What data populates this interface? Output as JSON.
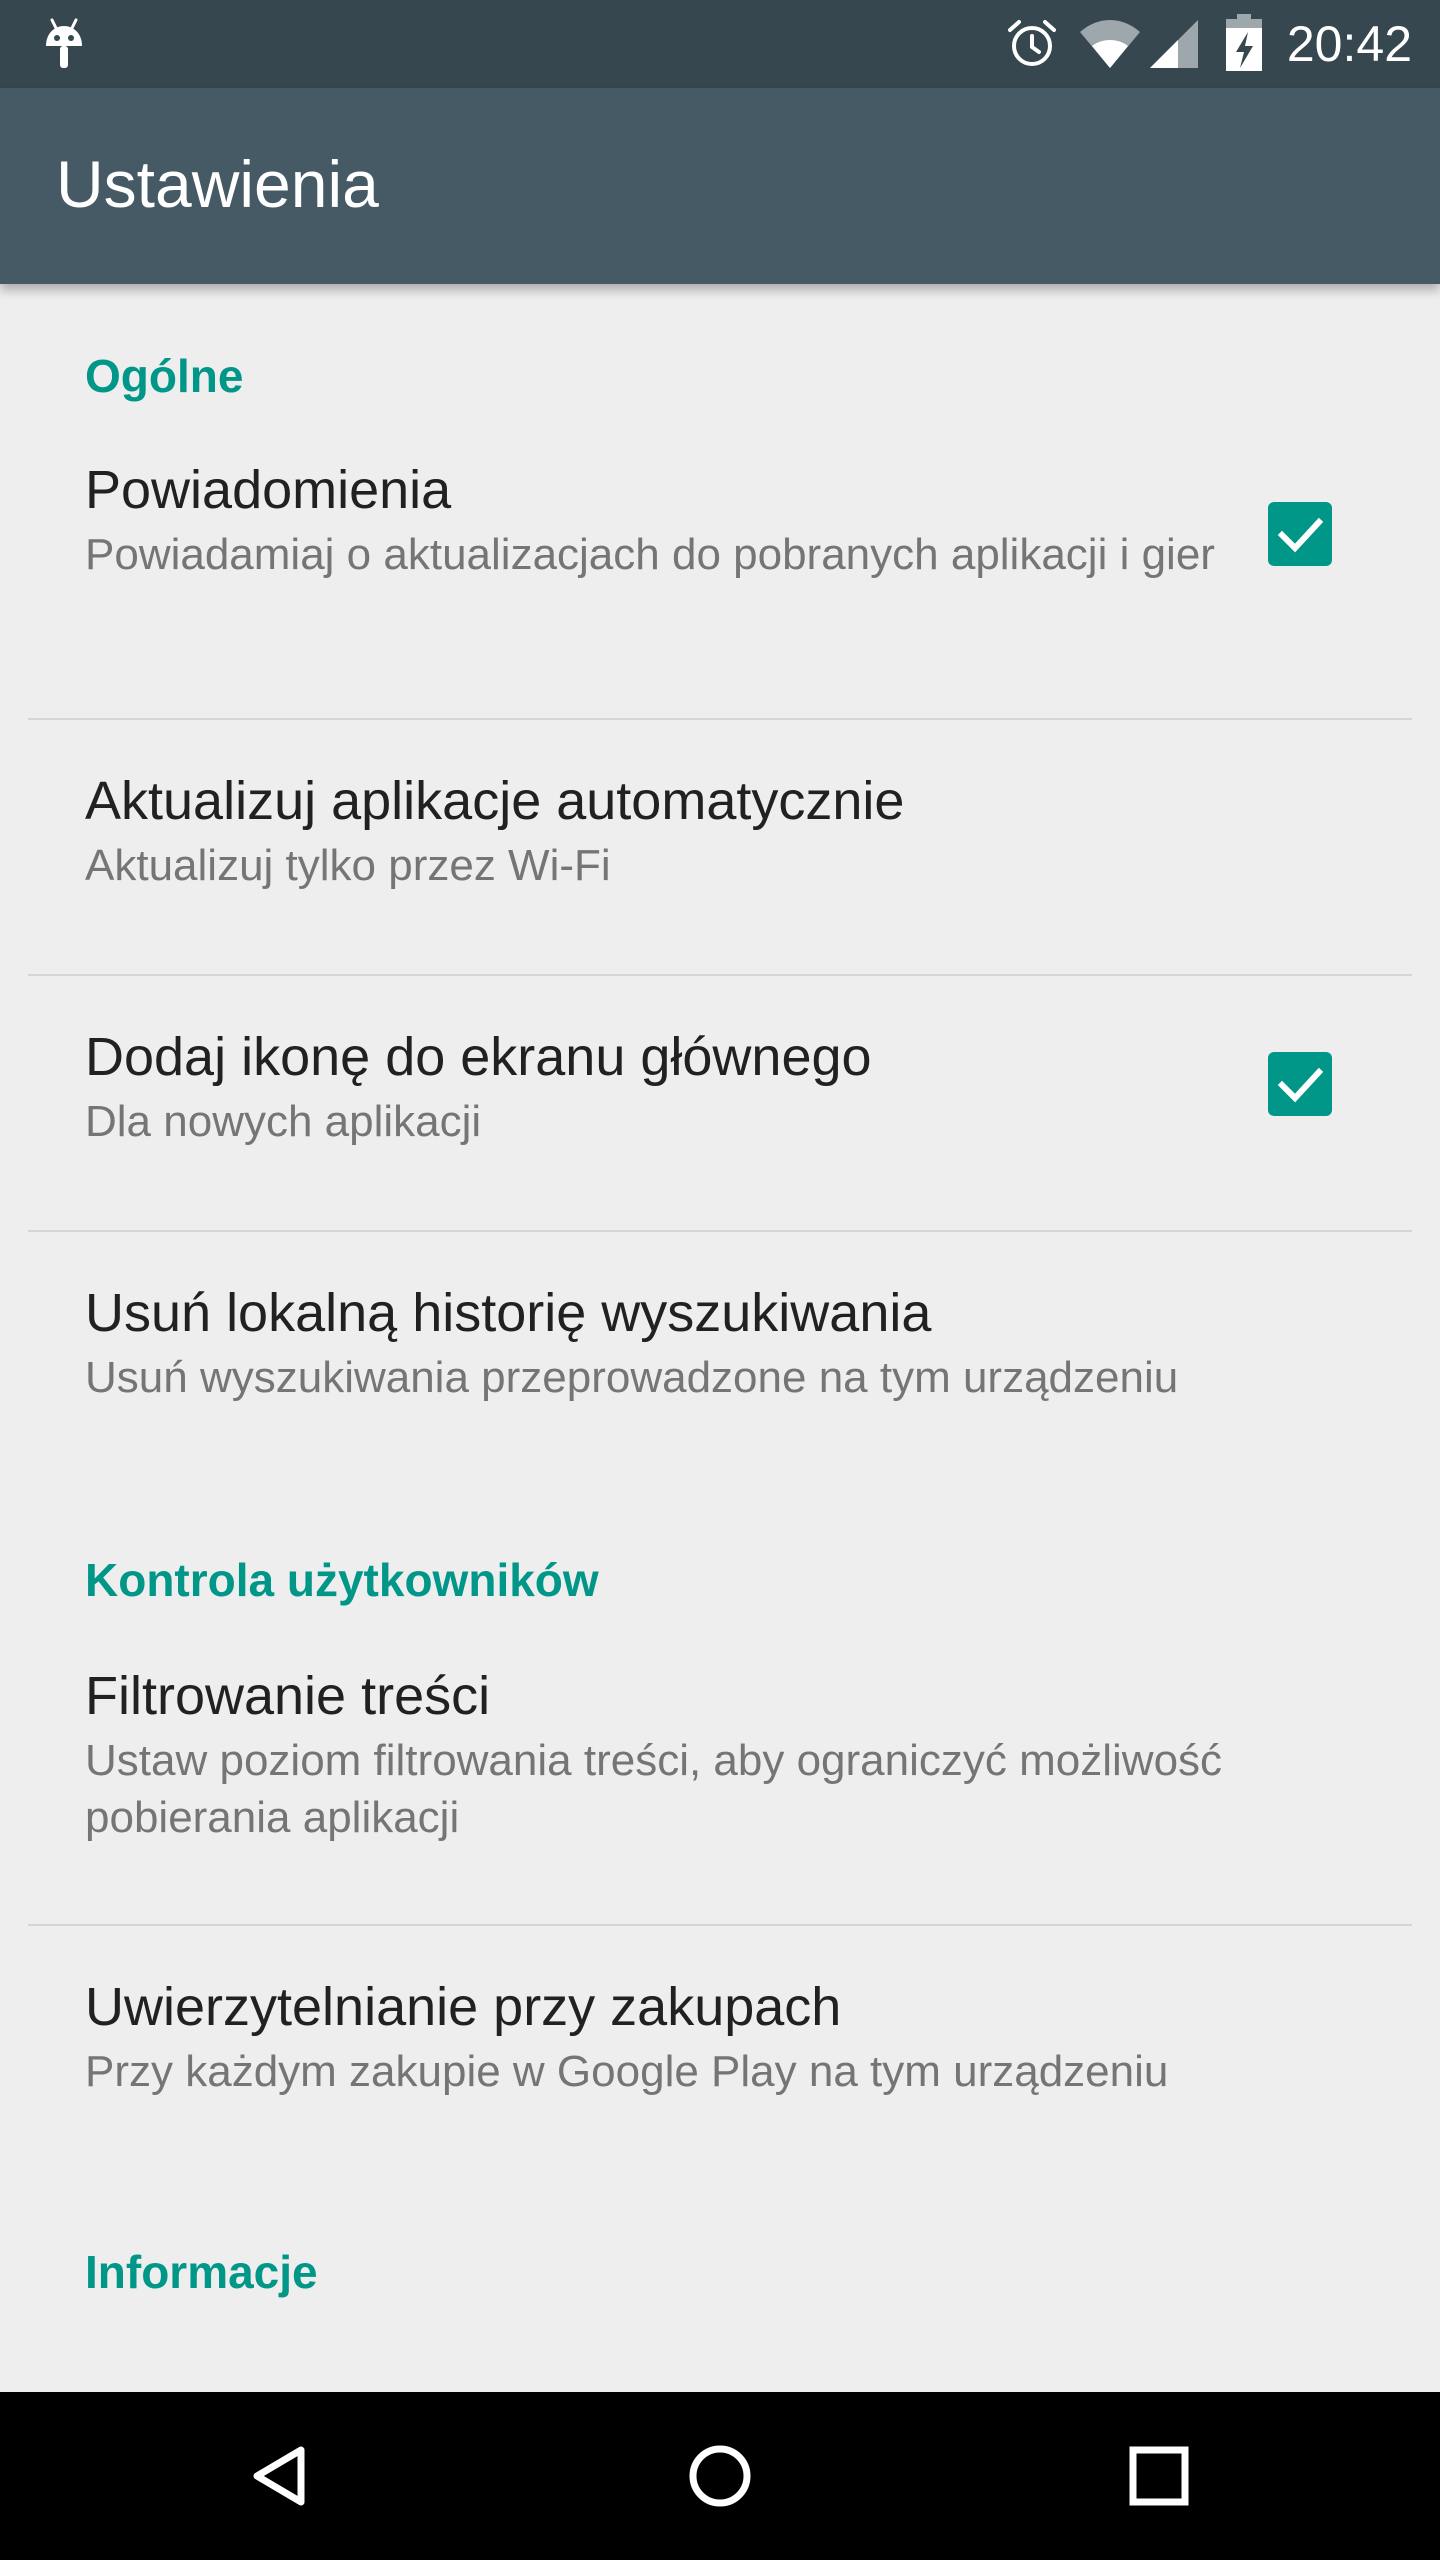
{
  "status_bar": {
    "time": "20:42",
    "icons": [
      "android-notification-icon",
      "alarm-icon",
      "wifi-icon",
      "cell-signal-icon",
      "battery-charging-icon"
    ]
  },
  "app_bar": {
    "title": "Ustawienia"
  },
  "sections": [
    {
      "header": "Ogólne",
      "items": [
        {
          "title": "Powiadomienia",
          "summary": "Powiadamiaj o aktualizacjach do pobranych aplikacji i gier",
          "checkbox": true,
          "checked": true
        },
        {
          "title": "Aktualizuj aplikacje automatycznie",
          "summary": "Aktualizuj tylko przez Wi-Fi",
          "checkbox": false
        },
        {
          "title": "Dodaj ikonę do ekranu głównego",
          "summary": "Dla nowych aplikacji",
          "checkbox": true,
          "checked": true
        },
        {
          "title": "Usuń lokalną historię wyszukiwania",
          "summary": "Usuń wyszukiwania przeprowadzone na tym urządzeniu",
          "checkbox": false
        }
      ]
    },
    {
      "header": "Kontrola użytkowników",
      "items": [
        {
          "title": "Filtrowanie treści",
          "summary": "Ustaw poziom filtrowania treści, aby ograniczyć możliwość pobierania aplikacji",
          "checkbox": false
        },
        {
          "title": "Uwierzytelnianie przy zakupach",
          "summary": "Przy każdym zakupie w Google Play na tym urządzeniu",
          "checkbox": false
        }
      ]
    },
    {
      "header": "Informacje",
      "items": []
    }
  ],
  "nav_bar": {
    "buttons": [
      "back-icon",
      "home-icon",
      "recents-icon"
    ]
  },
  "colors": {
    "status_bar": "#37474f",
    "app_bar": "#455a64",
    "accent": "#009688",
    "background": "#eeeeee"
  }
}
